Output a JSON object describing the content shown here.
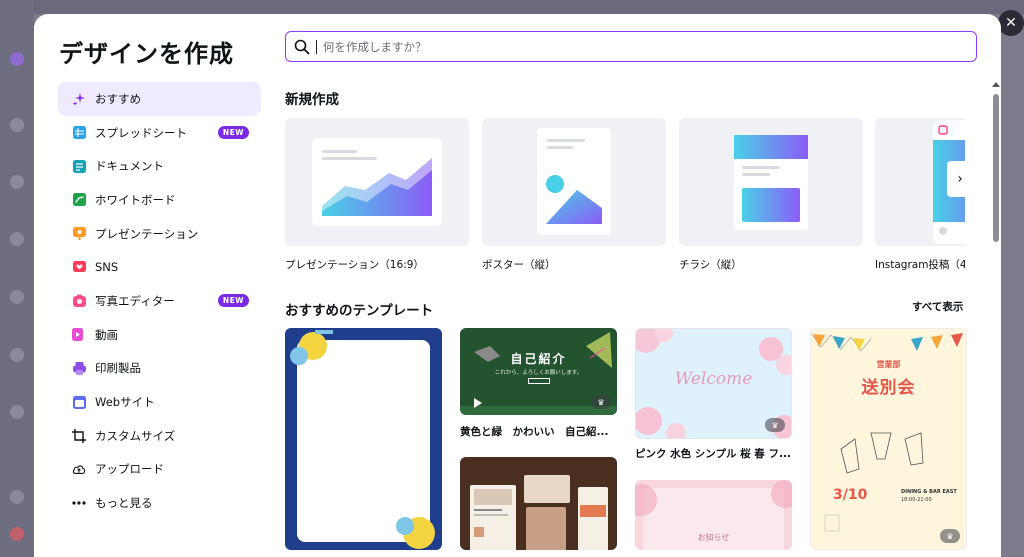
{
  "modal": {
    "title": "デザインを作成",
    "close_icon": "close-icon"
  },
  "search": {
    "placeholder": "何を作成しますか？"
  },
  "sidebar": {
    "items": [
      {
        "label": "おすすめ",
        "icon": "sparkle-icon",
        "color": "#7d2ae8",
        "active": true
      },
      {
        "label": "スプレッドシート",
        "icon": "spreadsheet-icon",
        "color": "#2aa3e8",
        "badge": "NEW"
      },
      {
        "label": "ドキュメント",
        "icon": "document-icon",
        "color": "#13a3b5"
      },
      {
        "label": "ホワイトボード",
        "icon": "whiteboard-icon",
        "color": "#1fa34a"
      },
      {
        "label": "プレゼンテーション",
        "icon": "presentation-icon",
        "color": "#ff9a1f"
      },
      {
        "label": "SNS",
        "icon": "heart-icon",
        "color": "#ff3b5c"
      },
      {
        "label": "写真エディター",
        "icon": "camera-icon",
        "color": "#ff4f8b",
        "badge": "NEW"
      },
      {
        "label": "動画",
        "icon": "video-icon",
        "color": "#e94bd6"
      },
      {
        "label": "印刷製品",
        "icon": "printer-icon",
        "color": "#8e4ce9"
      },
      {
        "label": "Webサイト",
        "icon": "website-icon",
        "color": "#5b6cf0"
      },
      {
        "label": "カスタムサイズ",
        "icon": "crop-icon",
        "color": "#0e1318"
      },
      {
        "label": "アップロード",
        "icon": "cloud-upload-icon",
        "color": "#0e1318"
      },
      {
        "label": "もっと見る",
        "icon": "more-icon",
        "color": "#0e1318"
      }
    ]
  },
  "new_section": {
    "title": "新規作成",
    "cards": [
      {
        "label": "プレゼンテーション（16:9）"
      },
      {
        "label": "ポスター（縦）"
      },
      {
        "label": "チラシ（縦）"
      },
      {
        "label": "Instagram投稿（4"
      }
    ]
  },
  "templates_section": {
    "title": "おすすめのテンプレート",
    "see_all": "すべて表示",
    "items": [
      {
        "label": ""
      },
      {
        "label": "黄色と緑　かわいい　自己紹..."
      },
      {
        "label": "ピンク 水色 シンプル 桜 春 フ..."
      },
      {
        "label": ""
      }
    ],
    "thumb_text": {
      "self_intro": "自己紹介",
      "self_intro_sub": "これから、よろしくお願いします。",
      "welcome": "Welcome",
      "farewell_top": "営業部",
      "farewell_main": "送別会",
      "farewell_date": "3/10",
      "farewell_venue": "DINING & BAR EAST",
      "farewell_time": "18:00-21:00",
      "notice": "お知らせ"
    }
  },
  "colors": {
    "accent": "#8b3dff",
    "badge": "#7d2ae8",
    "active_bg": "#efeafd"
  }
}
